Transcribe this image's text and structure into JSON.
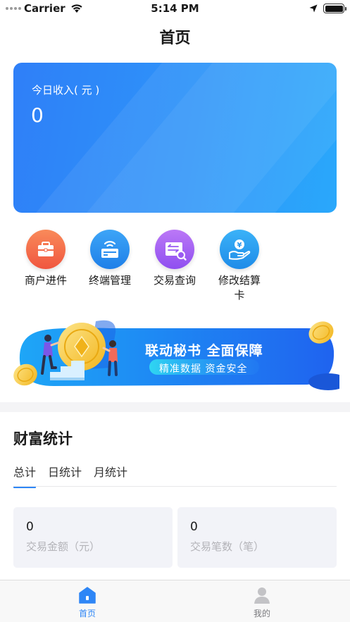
{
  "status_bar": {
    "carrier": "Carrier",
    "time": "5:14 PM"
  },
  "nav": {
    "title": "首页"
  },
  "income_card": {
    "label": "今日收入( 元 )",
    "value": "0"
  },
  "quick_menu": [
    {
      "label": "商户进件",
      "icon": "briefcase-icon",
      "color": "#f56b4d"
    },
    {
      "label": "终端管理",
      "icon": "pos-terminal-icon",
      "color": "#2d8ef5"
    },
    {
      "label": "交易查询",
      "icon": "transaction-search-icon",
      "color": "#a45cf0"
    },
    {
      "label": "修改结算卡",
      "icon": "settlement-card-icon",
      "color": "#2aa0f5"
    }
  ],
  "banner": {
    "headline": "联动秘书 全面保障",
    "tagline": "精准数据 资金安全"
  },
  "stats": {
    "title": "财富统计",
    "tabs": [
      "总计",
      "日统计",
      "月统计"
    ],
    "active_tab": "总计",
    "cards": [
      {
        "value": "0",
        "label": "交易金额（元）"
      },
      {
        "value": "0",
        "label": "交易笔数（笔）"
      }
    ]
  },
  "tab_bar": {
    "items": [
      {
        "label": "首页",
        "icon": "home-icon",
        "active": true
      },
      {
        "label": "我的",
        "icon": "profile-icon",
        "active": false
      }
    ]
  },
  "colors": {
    "accent": "#2e86f6",
    "card_gradient_start": "#2f7ff8",
    "card_gradient_end": "#2aa8fb"
  }
}
